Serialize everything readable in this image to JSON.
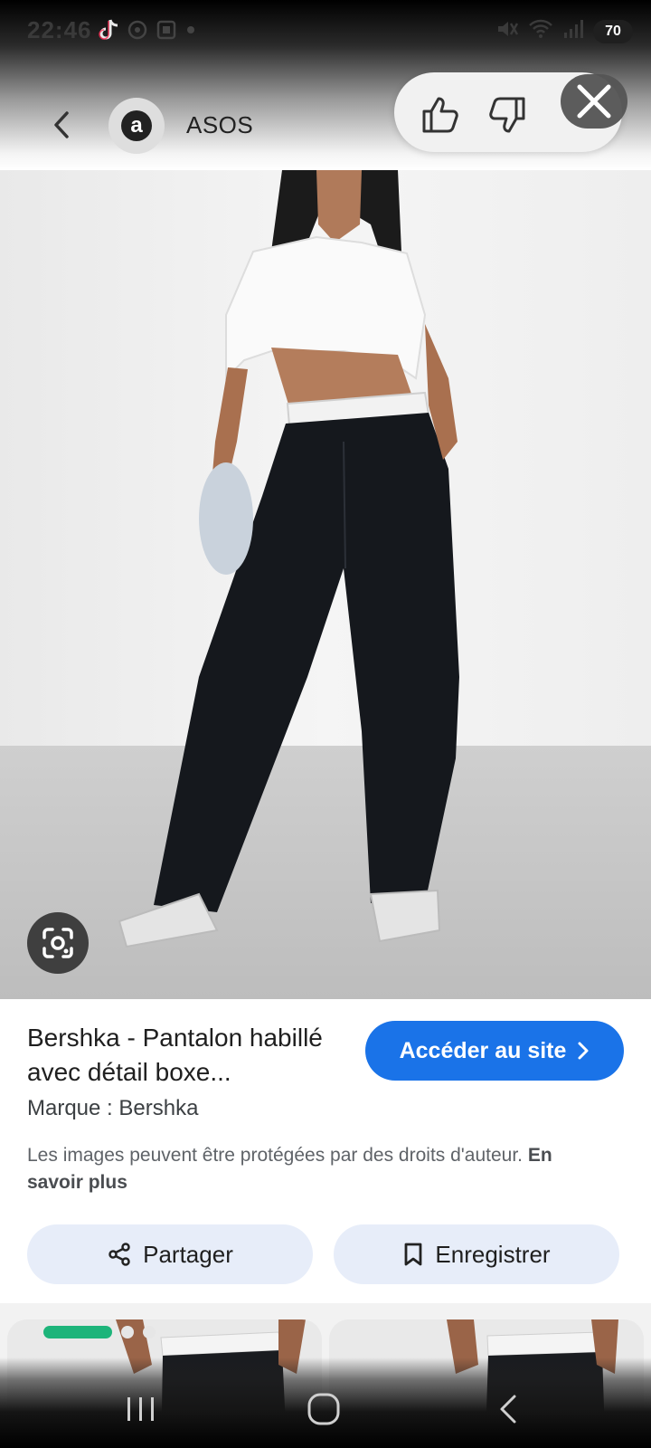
{
  "status_bar": {
    "time": "22:46",
    "battery": "70",
    "left_icons": [
      "tiktok-icon",
      "notification-icon",
      "gallery-icon",
      "more-dot-icon"
    ],
    "right_icons": [
      "mute-icon",
      "wifi-icon",
      "signal-icon"
    ]
  },
  "header": {
    "source_initial": "a",
    "source_name": "ASOS"
  },
  "product": {
    "title": "Bershka - Pantalon habillé avec détail boxe...",
    "visit_label": "Accéder au site",
    "brand_line": "Marque : Bershka",
    "copyright_text": "Les images peuvent être protégées par des droits d'auteur. ",
    "learn_more": "En savoir plus"
  },
  "actions": {
    "share_label": "Partager",
    "save_label": "Enregistrer"
  },
  "colors": {
    "accent": "#1a73e8",
    "action_bg": "#e7edf9",
    "indicator": "#1db47a"
  },
  "related": {
    "active_index": 0,
    "count": 3
  }
}
